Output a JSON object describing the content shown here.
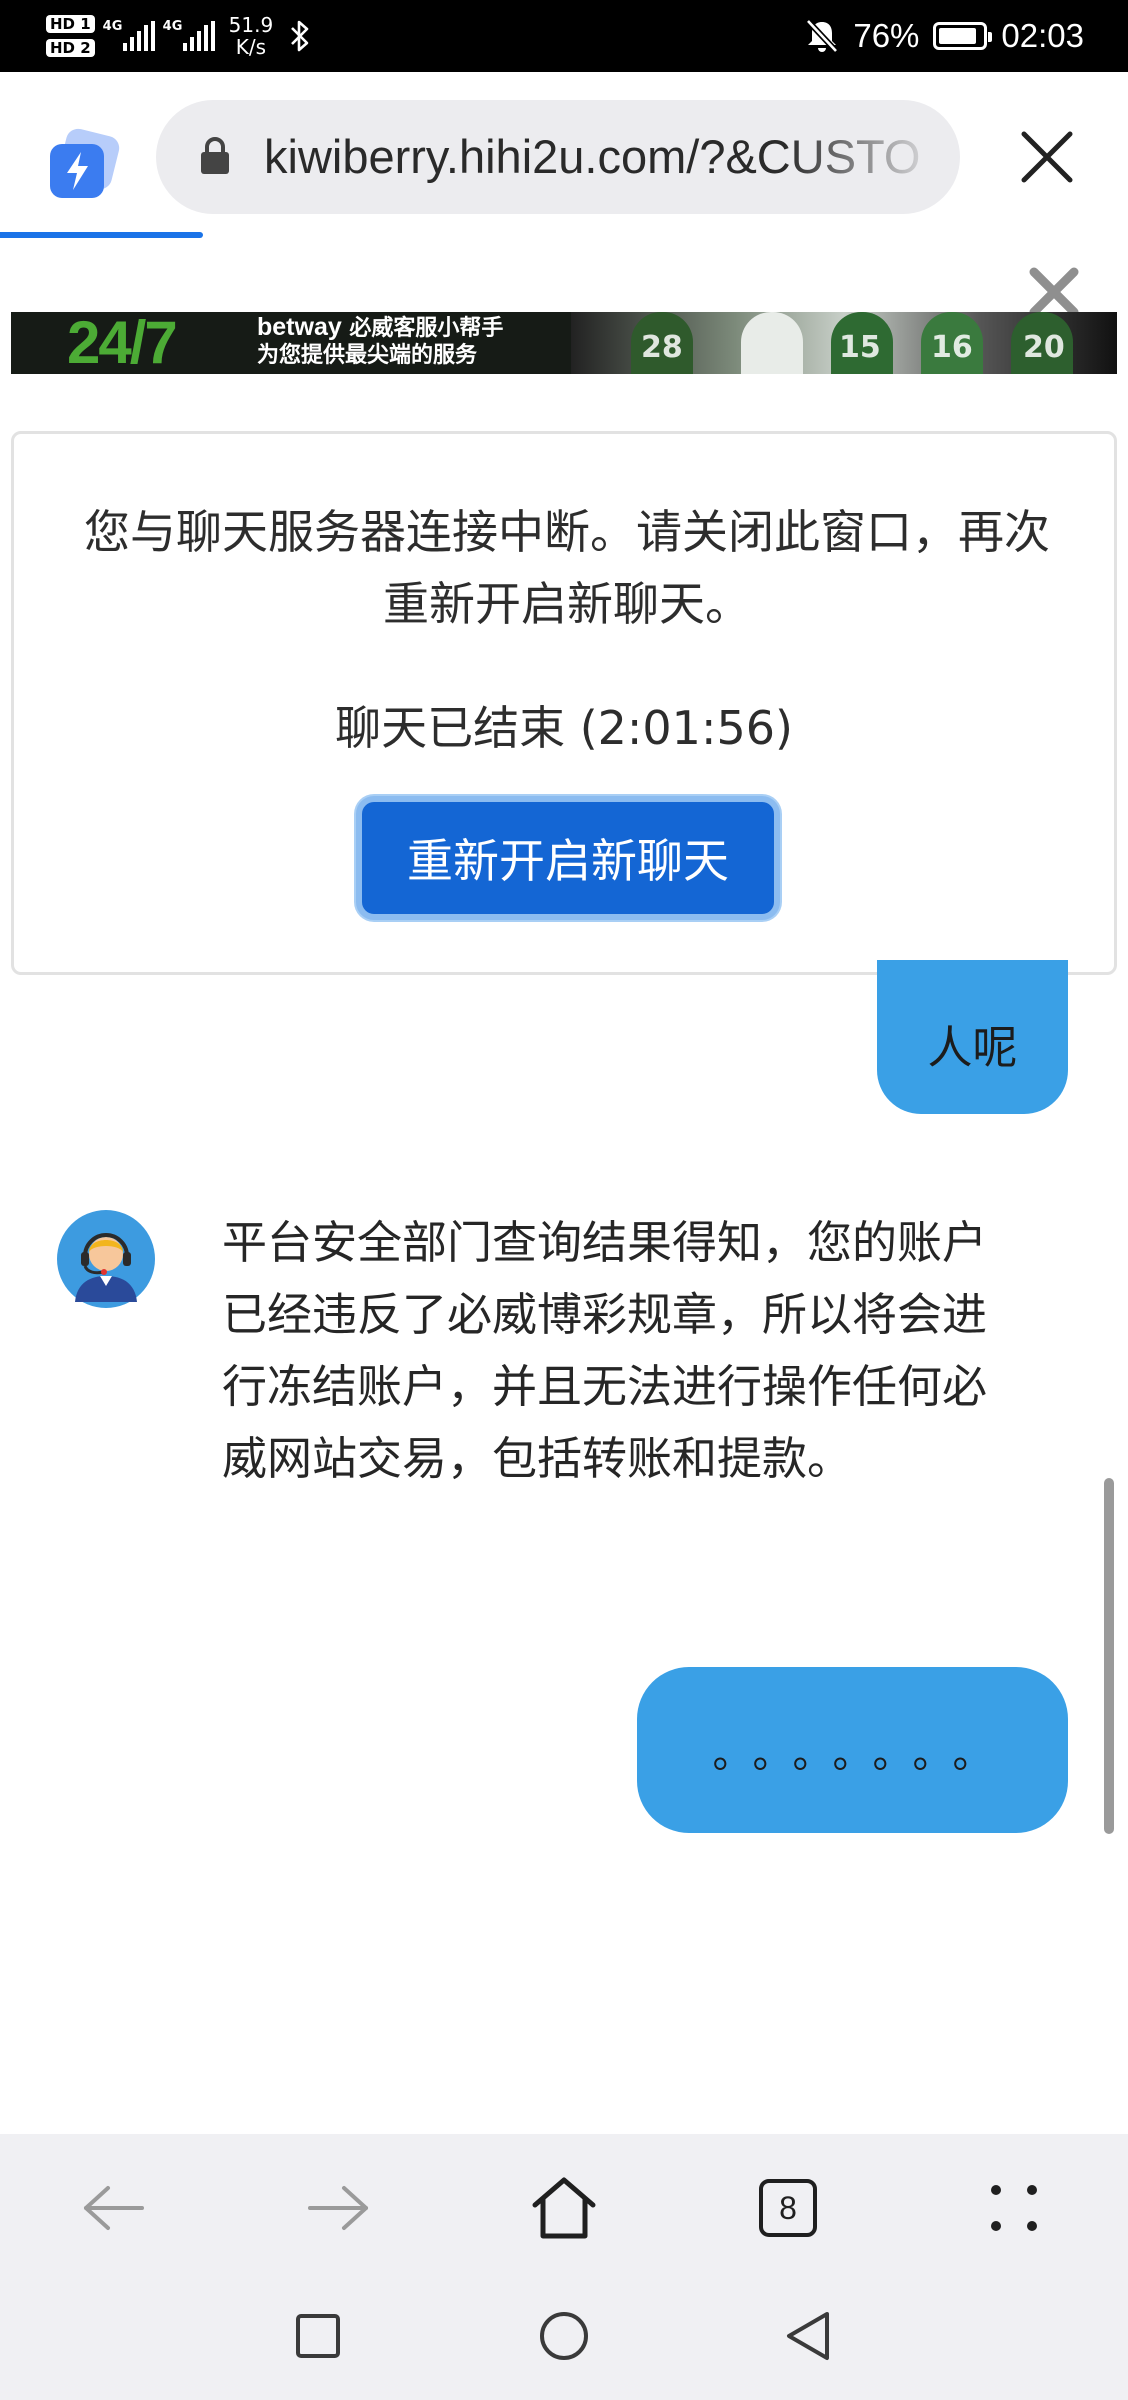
{
  "status_bar": {
    "hd1": "HD 1",
    "hd2": "HD 2",
    "net1": "4G",
    "net2": "4G",
    "speed_value": "51.9",
    "speed_unit": "K/s",
    "battery_percent": "76%",
    "battery_level": 0.76,
    "time": "02:03",
    "icons": [
      "bluetooth-icon",
      "mute-bell-icon",
      "battery-icon"
    ]
  },
  "browser": {
    "url": "kiwiberry.hihi2u.com/?&CUSTO",
    "page_load_progress": 0.18,
    "tab_count": "8",
    "accent_color": "#1a73e8"
  },
  "banner": {
    "headline": "24/7",
    "brand": "betway",
    "line1_tail": " 必威客服小帮手",
    "line2": "为您提供最尖端的服务",
    "jersey_numbers": [
      "28",
      "15",
      "16",
      "20"
    ]
  },
  "alert": {
    "message": "您与聊天服务器连接中断。请关闭此窗口，再次重新开启新聊天。",
    "ended_label": "聊天已结束 (2:01:56)",
    "restart_button": "重新开启新聊天"
  },
  "chat": {
    "user_message_1": "人呢",
    "agent_message": "平台安全部门查询结果得知，您的账户已经违反了必威博彩规章，所以将会进行冻结账户，并且无法进行操作任何必威网站交易，包括转账和提款。",
    "user_message_2": "。。。。。。。",
    "bubble_color": "#3aa0e6"
  }
}
